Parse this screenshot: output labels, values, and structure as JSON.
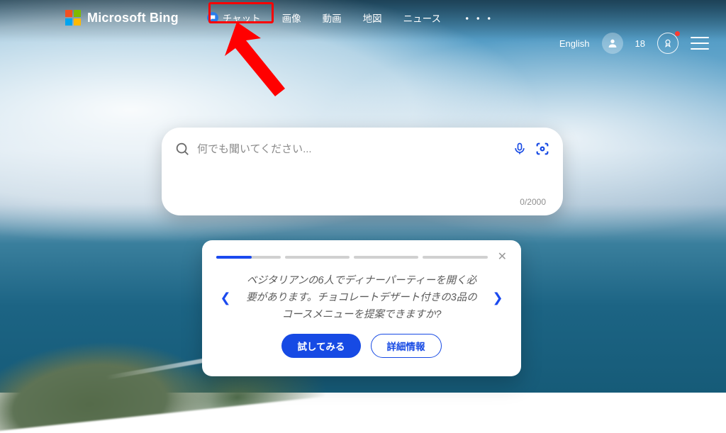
{
  "brand": "Microsoft Bing",
  "nav": {
    "chat": "チャット",
    "images": "画像",
    "videos": "動画",
    "maps": "地図",
    "news": "ニュース",
    "more": "・・・"
  },
  "header_right": {
    "language": "English",
    "points": "18"
  },
  "search": {
    "placeholder": "何でも聞いてください...",
    "value": "",
    "counter": "0/2000"
  },
  "suggestion_card": {
    "prompt": "ベジタリアンの6人でディナーパーティーを開く必要があります。チョコレートデザート付きの3品のコースメニューを提案できますか?",
    "try_label": "試してみる",
    "learn_more_label": "詳細情報",
    "progress_segments": 4,
    "progress_active_index": 0,
    "progress_active_fill_pct": 55
  },
  "annotation": {
    "highlight_target": "nav-chat",
    "arrow_color": "#ff0000"
  },
  "colors": {
    "accent": "#174ae4",
    "highlight": "#ff0000"
  }
}
